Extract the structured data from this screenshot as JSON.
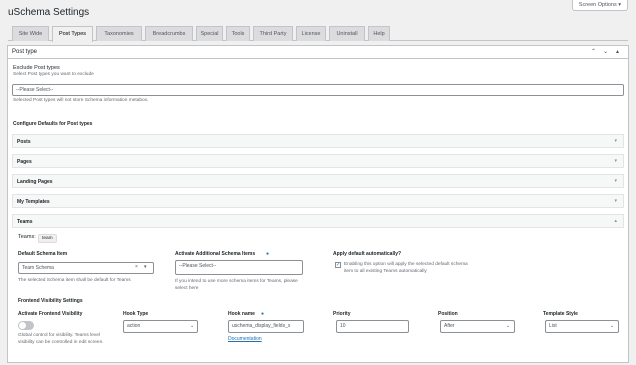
{
  "screen_options": "Screen Options ▾",
  "page_title": "uSchema Settings",
  "tabs": [
    "Site Wide",
    "Post Types",
    "Taxonomies",
    "Breadcrumbs",
    "Special",
    "Tools",
    "Third Party",
    "License",
    "Uninstall",
    "Help"
  ],
  "panel": {
    "title": "Post type",
    "controls": [
      "⌃",
      "⌄",
      "▴"
    ],
    "exclude": {
      "label": "Exclude Post types",
      "desc": "Select Post types you want to exclude",
      "placeholder": "--Please Select--",
      "note": "Selected Post types will not store Schema information metabox."
    },
    "configure_label": "Configure Defaults for Post types",
    "accordions": [
      "Posts",
      "Pages",
      "Landing Pages",
      "My Templates"
    ],
    "teams": {
      "label": "Teams",
      "slug_label": "Teams:",
      "slug_badge": "team",
      "default_schema": {
        "label": "Default Schema Item",
        "value": "Team Schema",
        "clear": "×",
        "hint": "The selected Schema item shall be default for Teams"
      },
      "additional": {
        "label": "Activate Additional Schema Items",
        "info": "●",
        "placeholder": "--Please Select--",
        "hint": "If you intend to use more schema items for Teams, please select here"
      },
      "apply_default": {
        "label": "Apply default automatically?",
        "check": "✓",
        "hint": "Enabling this option will apply the selected default schema item to all existing Teams automatically"
      },
      "frontend_title": "Frontend Visibility Settings",
      "frontend": {
        "visibility_label": "Activate Frontend Visibility",
        "visibility_hint": "Global control for visibility. Teams level visibility can be controlled in edit screen.",
        "hook_type_label": "Hook Type",
        "hook_type_value": "action",
        "hook_name_label": "Hook name",
        "hook_name_info": "●",
        "hook_name_value": "uschema_display_fields_s",
        "documentation": "Documentation",
        "priority_label": "Priority",
        "priority_value": "10",
        "position_label": "Position",
        "position_value": "After",
        "template_label": "Template Style",
        "template_value": "List"
      }
    }
  },
  "colors": {
    "link": "#2271b1",
    "border": "#c3c4c7",
    "background": "#f0f0f1"
  }
}
